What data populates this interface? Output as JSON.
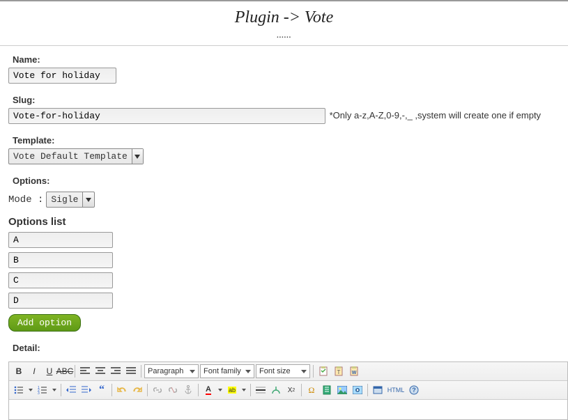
{
  "header": {
    "title": "Plugin -> Vote",
    "subtitle": "......"
  },
  "fields": {
    "name_label": "Name:",
    "name_value": "Vote for holiday",
    "slug_label": "Slug:",
    "slug_value": "Vote-for-holiday",
    "slug_hint": "*Only a-z,A-Z,0-9,-,_ ,system will create one if empty",
    "template_label": "Template:",
    "template_value": "Vote Default Template",
    "options_label": "Options:",
    "mode_label": "Mode :",
    "mode_value": "Sigle",
    "options_list_title": "Options list",
    "option_items": [
      "A",
      "B",
      "C",
      "D"
    ],
    "add_option_label": "Add option",
    "detail_label": "Detail:"
  },
  "editor": {
    "paragraph": "Paragraph",
    "font_family": "Font family",
    "font_size": "Font size",
    "html_label": "HTML"
  }
}
